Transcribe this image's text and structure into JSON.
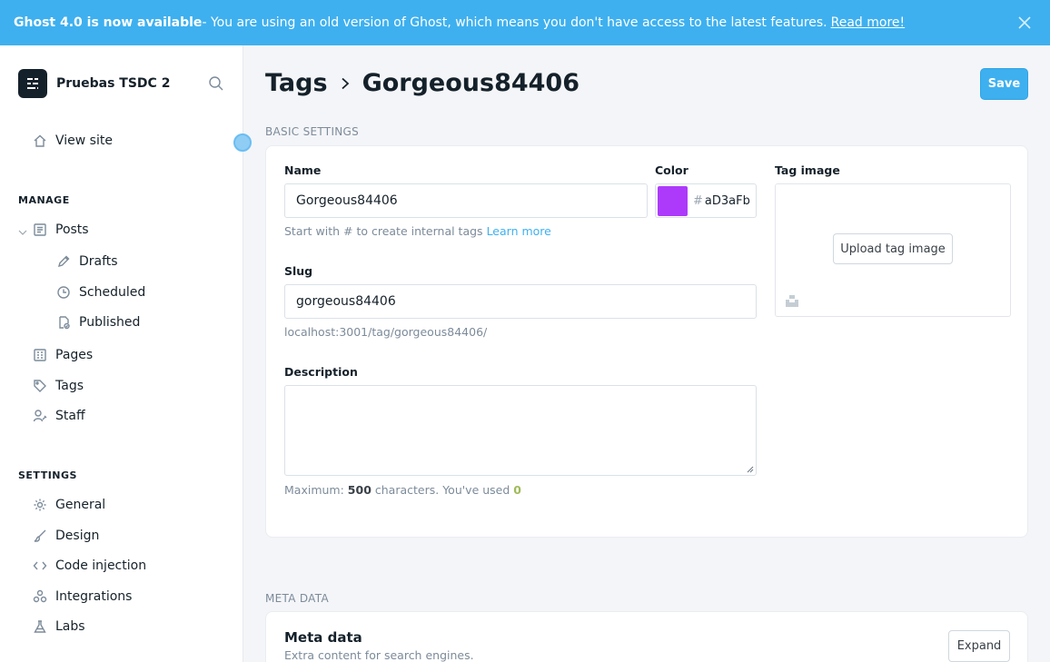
{
  "banner": {
    "bold": "Ghost 4.0 is now available",
    "text": " - You are using an old version of Ghost, which means you don't have access to the latest features.",
    "link": "Read more!"
  },
  "sidebar": {
    "site_name": "Pruebas TSDC 2",
    "view_site": "View site",
    "manage_label": "MANAGE",
    "posts": "Posts",
    "drafts": "Drafts",
    "scheduled": "Scheduled",
    "published": "Published",
    "pages": "Pages",
    "tags": "Tags",
    "staff": "Staff",
    "settings_label": "SETTINGS",
    "general": "General",
    "design": "Design",
    "code_injection": "Code injection",
    "integrations": "Integrations",
    "labs": "Labs"
  },
  "header": {
    "crumb_parent": "Tags",
    "crumb_current": "Gorgeous84406",
    "save": "Save"
  },
  "basic": {
    "section": "BASIC SETTINGS",
    "name_label": "Name",
    "name_value": "Gorgeous84406",
    "name_hint": "Start with # to create internal tags",
    "learn_more": "Learn more",
    "color_label": "Color",
    "color_hash": "#",
    "color_value": "aD3aFb",
    "color_hex": "#ad3afb",
    "image_label": "Tag image",
    "upload": "Upload tag image",
    "slug_label": "Slug",
    "slug_value": "gorgeous84406",
    "slug_url": "localhost:3001/tag/gorgeous84406/",
    "desc_label": "Description",
    "max_prefix": "Maximum:",
    "max_value": "500",
    "max_mid": "characters. You've used",
    "used_value": "0"
  },
  "meta": {
    "section": "META DATA",
    "title": "Meta data",
    "subtitle": "Extra content for search engines.",
    "expand": "Expand"
  }
}
